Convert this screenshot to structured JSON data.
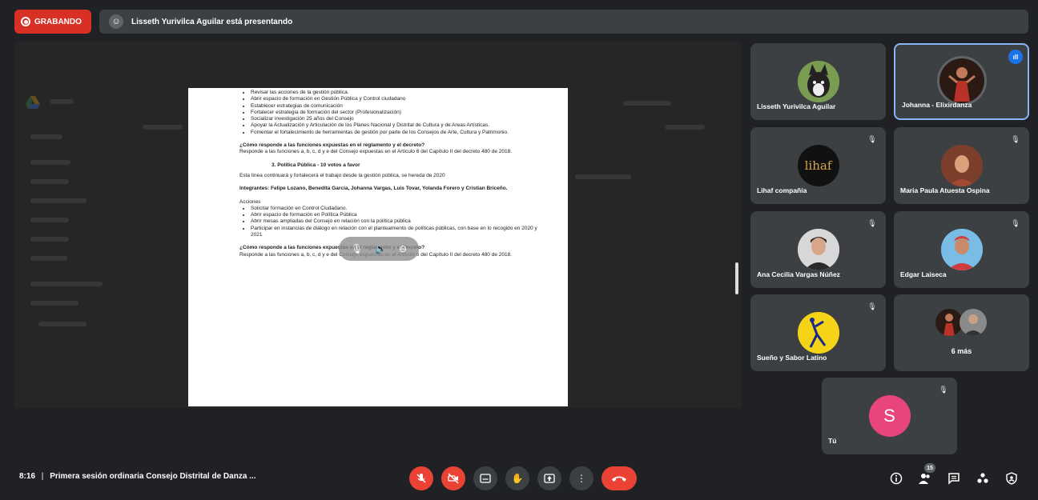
{
  "recording": {
    "label": "GRABANDO"
  },
  "presenting": {
    "text": "Lisseth Yurivilca Aguilar está presentando"
  },
  "slide": {
    "list1": [
      "Revisar las acciones de la gestión pública.",
      "Abrir espacio de formación en Gestión Pública y Control ciudadano",
      "Establecer estrategias de comunicación",
      "Fortalecer estrategia de formación del sector (Profesionalización)",
      "Socializar investigación 25 años del Consejo",
      "Apoyar la Actualización y Articulación de los Planes Nacional y Distrital de Cultura y de Areas Artísticas.",
      "Fomentar el fortalecimiento de herramientas de gestión por parte de los Consejos de Arte, Cultura y Patrimonio."
    ],
    "q1": "¿Cómo responde a las funciones expuestas en el reglamento y el decreto?",
    "a1": "Responde a las funciones a, b, c, d y e del Consejo expuestas en el Artículo 6 del Capítulo II del decreto 480 de 2018.",
    "heading": "3.   Política Pública - 10 votos a favor",
    "line": "Esta línea continuará y fortalecerá el trabajo desde la gestión pública, se heredа de 2020",
    "members": "Integrantes: Felipe Lozano, Benedita García, Johanna Vargas, Luis Tovar, Yolanda Forero y Cristian Briceño.",
    "acciones": "Acciones",
    "list2": [
      "Solicitar formación en Control Ciudadano.",
      "Abrir espacio de formación en Política Pública",
      "Abrir mesas ampliadas del Consejo en relación con la política pública",
      "Participar en instancias de diálogo en relación con el planteamiento de políticas públicas, con base en lo recogido en 2020 y 2021"
    ],
    "q2": "¿Cómo responde a las funciones expuestas en el reglamento y el decreto?",
    "a2": "Responde a las funciones a, b, c, d y e del Consejo expuestas en el Artículo 6 del Capítulo II del decreto 480 de 2018."
  },
  "participants": [
    {
      "name": "Lisseth Yurivilca Aguilar",
      "muted": false
    },
    {
      "name": "Johanna - Elixirdanza",
      "speaking": true
    },
    {
      "name": "Lihaf compañía",
      "muted": true,
      "avatar_text": "lihaf"
    },
    {
      "name": "Maria Paula Atuesta Ospina",
      "muted": true
    },
    {
      "name": "Ana Cecilia Vargas Núñez",
      "muted": true
    },
    {
      "name": "Edgar Laiseca",
      "muted": true
    },
    {
      "name": "Sueño y Sabor Latino",
      "muted": true
    },
    {
      "name": "6 más"
    },
    {
      "name": "Tú",
      "muted": true,
      "initial": "S"
    }
  ],
  "meeting": {
    "time": "8:16",
    "separator": "|",
    "title": "Primera sesión ordinaria Consejo Distrital de Danza ..."
  },
  "people_count": "15",
  "colors": {
    "record": "#d93025",
    "end_call": "#ea4335",
    "active_border": "#8ab4f8",
    "self_avatar": "#e8457c"
  }
}
